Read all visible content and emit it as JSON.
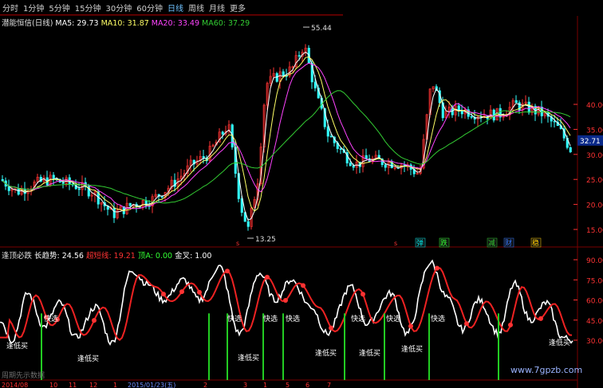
{
  "toolbar": {
    "tabs": [
      "分时",
      "1分钟",
      "5分钟",
      "15分钟",
      "30分钟",
      "60分钟",
      "日线",
      "周线",
      "月线",
      "更多"
    ],
    "active_tab": "日线"
  },
  "main_panel": {
    "title": "潜能恒信(日线)",
    "ma": [
      {
        "label": "MA5: 29.73",
        "color": "#ffffff"
      },
      {
        "label": "MA10: 31.87",
        "color": "#ffff66"
      },
      {
        "label": "MA20: 33.49",
        "color": "#ff44ff"
      },
      {
        "label": "MA60: 37.29",
        "color": "#33cc33"
      }
    ],
    "high_label": "55.44",
    "low_label": "13.25",
    "current_price": "32.71",
    "axis_ticks": [
      "40.00",
      "35.00",
      "30.00",
      "25.00",
      "20.00",
      "15.00"
    ],
    "signals": [
      {
        "label": "弹",
        "color": "#00e5e5"
      },
      {
        "label": "跌",
        "color": "#33ff33"
      },
      {
        "label": "减",
        "color": "#33cc33"
      },
      {
        "label": "财",
        "color": "#3377ff"
      },
      {
        "label": "稳",
        "color": "#ffcc00"
      }
    ]
  },
  "indicator_panel": {
    "name": "逢顶必跌",
    "values": [
      {
        "label": "长趋势: 24.56",
        "color": "#ffffff"
      },
      {
        "label": "超短线: 19.21",
        "color": "#ff3333"
      },
      {
        "label": "顶A: 0.00",
        "color": "#33ff33"
      },
      {
        "label": "金叉: 1.00",
        "color": "#ffffff"
      }
    ],
    "axis_ticks": [
      "90.00",
      "75.00",
      "60.00",
      "45.00",
      "30.00"
    ],
    "buy_label": "逢低买",
    "fast_label": "快选"
  },
  "date_axis": {
    "labels": [
      "2014/08",
      "10",
      "11",
      "12",
      "1",
      "2015/01/23(五)",
      "2",
      "3",
      "1",
      "5",
      "6",
      "7"
    ],
    "footer_text": "周期先示数据"
  },
  "watermark": "www.7gpzb.com",
  "colors": {
    "up": "#ff3333",
    "down": "#33ffff",
    "grid": "#7a0000",
    "axis_text": "#ff3333"
  }
}
